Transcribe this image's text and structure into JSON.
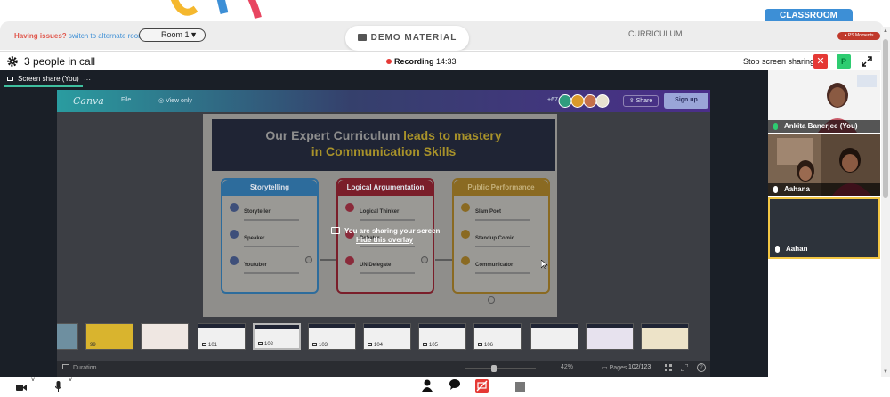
{
  "header": {
    "classroom_tab": "CLASSROOM",
    "issues_question": "Having issues?",
    "issues_link": "switch to alternate room",
    "room_select": "Room 1",
    "demo_material": "DEMO MATERIAL",
    "curriculum_tab": "CURRICULUM",
    "ps_moments": "PS Moments"
  },
  "call": {
    "people_count": "3 people in call",
    "recording_label": "Recording",
    "recording_time": "14:33",
    "stop_sharing": "Stop screen sharing",
    "close_symbol": "✕",
    "participant_initial": "P"
  },
  "screen_share": {
    "tab_label": "Screen share (You)",
    "more": "···",
    "overlay_message": "You are sharing your screen",
    "overlay_hide": "Hide this overlay"
  },
  "canva": {
    "logo": "Canva",
    "file_menu": "File",
    "view_only": "View only",
    "collaborators_extra": "+67",
    "share_button": "Share",
    "signup_button": "Sign up",
    "slide": {
      "title_part1": "Our Expert Curriculum",
      "title_highlight1": "leads to mastery",
      "title_part2": "in Communication Skills",
      "columns": [
        {
          "head": "Storytelling",
          "items": [
            "Storyteller",
            "Speaker",
            "Youtuber"
          ]
        },
        {
          "head": "Logical Argumentation",
          "items": [
            "Logical Thinker",
            "Debater",
            "UN Delegate"
          ]
        },
        {
          "head": "Public Performance",
          "items": [
            "Slam Poet",
            "Standup Comic",
            "Communicator"
          ]
        }
      ]
    },
    "thumbnails": [
      {
        "num": "99"
      },
      {
        "num": ""
      },
      {
        "num": "101"
      },
      {
        "num": "102"
      },
      {
        "num": "103"
      },
      {
        "num": "104"
      },
      {
        "num": "105"
      },
      {
        "num": "106"
      },
      {
        "num": ""
      },
      {
        "num": ""
      },
      {
        "num": ""
      }
    ],
    "bottom": {
      "duration": "Duration",
      "zoom": "42%",
      "pages_label": "Pages",
      "page_counter": "102/123",
      "help": "?"
    }
  },
  "participants": [
    {
      "name": "Ankita Banerjee (You)"
    },
    {
      "name": "Aahana"
    },
    {
      "name": "Aahan"
    }
  ],
  "colors": {
    "accent_blue": "#3d8fd6",
    "record_red": "#e53935",
    "active_green": "#2ecc71",
    "speaker_border": "#f3c744"
  }
}
